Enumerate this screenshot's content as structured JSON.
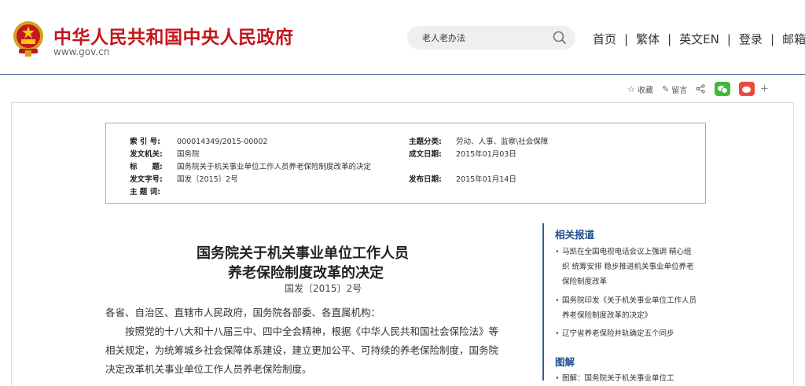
{
  "header": {
    "site_name": "中华人民共和国中央人民政府",
    "site_url": "www.gov.cn",
    "search_value": "老人老办法",
    "nav": [
      "首页",
      "繁体",
      "英文EN",
      "登录",
      "邮箱"
    ]
  },
  "share": {
    "favorite": "收藏",
    "comment": "留言"
  },
  "info": {
    "index_label": "索 引 号:",
    "index_value": "000014349/2015-00002",
    "category_label": "主题分类:",
    "category_value": "劳动、人事、监察\\社会保障",
    "issuer_label": "发文机关:",
    "issuer_value": "国务院",
    "created_label": "成文日期:",
    "created_value": "2015年01月03日",
    "title_label": "标　　题:",
    "title_value": "国务院关于机关事业单位工作人员养老保险制度改革的决定",
    "docno_label": "发文字号:",
    "docno_value": "国发〔2015〕2号",
    "published_label": "发布日期:",
    "published_value": "2015年01月14日",
    "keywords_label": "主 题 词:"
  },
  "article": {
    "title_line1": "国务院关于机关事业单位工作人员",
    "title_line2": "养老保险制度改革的决定",
    "doc_number": "国发〔2015〕2号",
    "salutation": "各省、自治区、直辖市人民政府，国务院各部委、各直属机构：",
    "para1_line1": "　　按照党的十八大和十八届三中、四中全会精神，根据《中华人民共和国社会保险法》等",
    "para1_line2": "相关规定，为统筹城乡社会保障体系建设，建立更加公平、可持续的养老保险制度，国务院",
    "para1_line3": "决定改革机关事业单位工作人员养老保险制度。"
  },
  "sidebar": {
    "related_title": "相关报道",
    "related_items": [
      "马凯在全国电视电话会议上强调 精心组织 统筹安排 稳步推进机关事业单位养老保险制度改革",
      "国务院印发《关于机关事业单位工作人员养老保险制度改革的决定》",
      "辽宁省养老保险并轨确定五个同步"
    ],
    "explain_title": "图解",
    "explain_item": "图解：国务院关于机关事业单位工"
  },
  "colors": {
    "brand_red": "#c4161c",
    "link_blue": "#1f4e8c",
    "wechat_green": "#3fb838",
    "weibo_red": "#e94c3f"
  }
}
